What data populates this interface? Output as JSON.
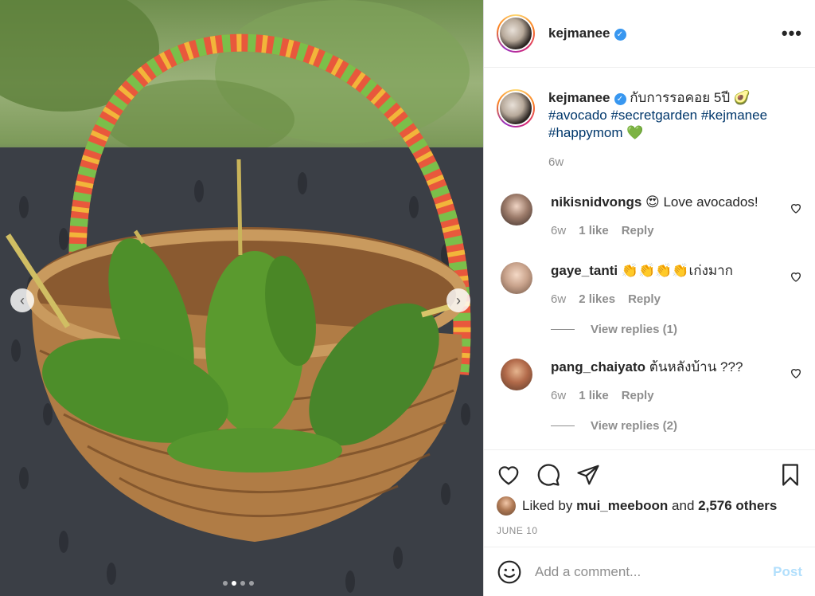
{
  "post": {
    "author": "kejmanee",
    "more_icon": "more-horizontal-icon",
    "carousel": {
      "total_slides": 4,
      "active_slide": 2
    }
  },
  "caption": {
    "username": "kejmanee",
    "text": "กับการรอคอย 5ปี 🥑",
    "hashtags_line1": "#avocado #secretgarden #kejmanee",
    "hashtags_line2": "#happymom",
    "emoji_end": "💚",
    "time": "6w"
  },
  "comments": [
    {
      "username": "nikisnidvongs",
      "text": "😍 Love avocados!",
      "time": "6w",
      "likes": "1 like",
      "reply": "Reply",
      "view_replies": ""
    },
    {
      "username": "gaye_tanti",
      "text": "👏👏👏👏เก่งมาก",
      "time": "6w",
      "likes": "2 likes",
      "reply": "Reply",
      "view_replies": "View replies (1)"
    },
    {
      "username": "pang_chaiyato",
      "text": "ต้นหลังบ้าน ???",
      "time": "6w",
      "likes": "1 like",
      "reply": "Reply",
      "view_replies": "View replies (2)"
    }
  ],
  "likes": {
    "liked_by_prefix": "Liked by",
    "liked_by_user": "mui_meeboon",
    "and": "and",
    "others": "2,576 others"
  },
  "date": "JUNE 10",
  "composer": {
    "placeholder": "Add a comment...",
    "post_label": "Post"
  },
  "colors": {
    "link": "#00376b",
    "muted": "#8e8e8e",
    "verified": "#3897f0",
    "post_disabled": "#b2dffc"
  }
}
